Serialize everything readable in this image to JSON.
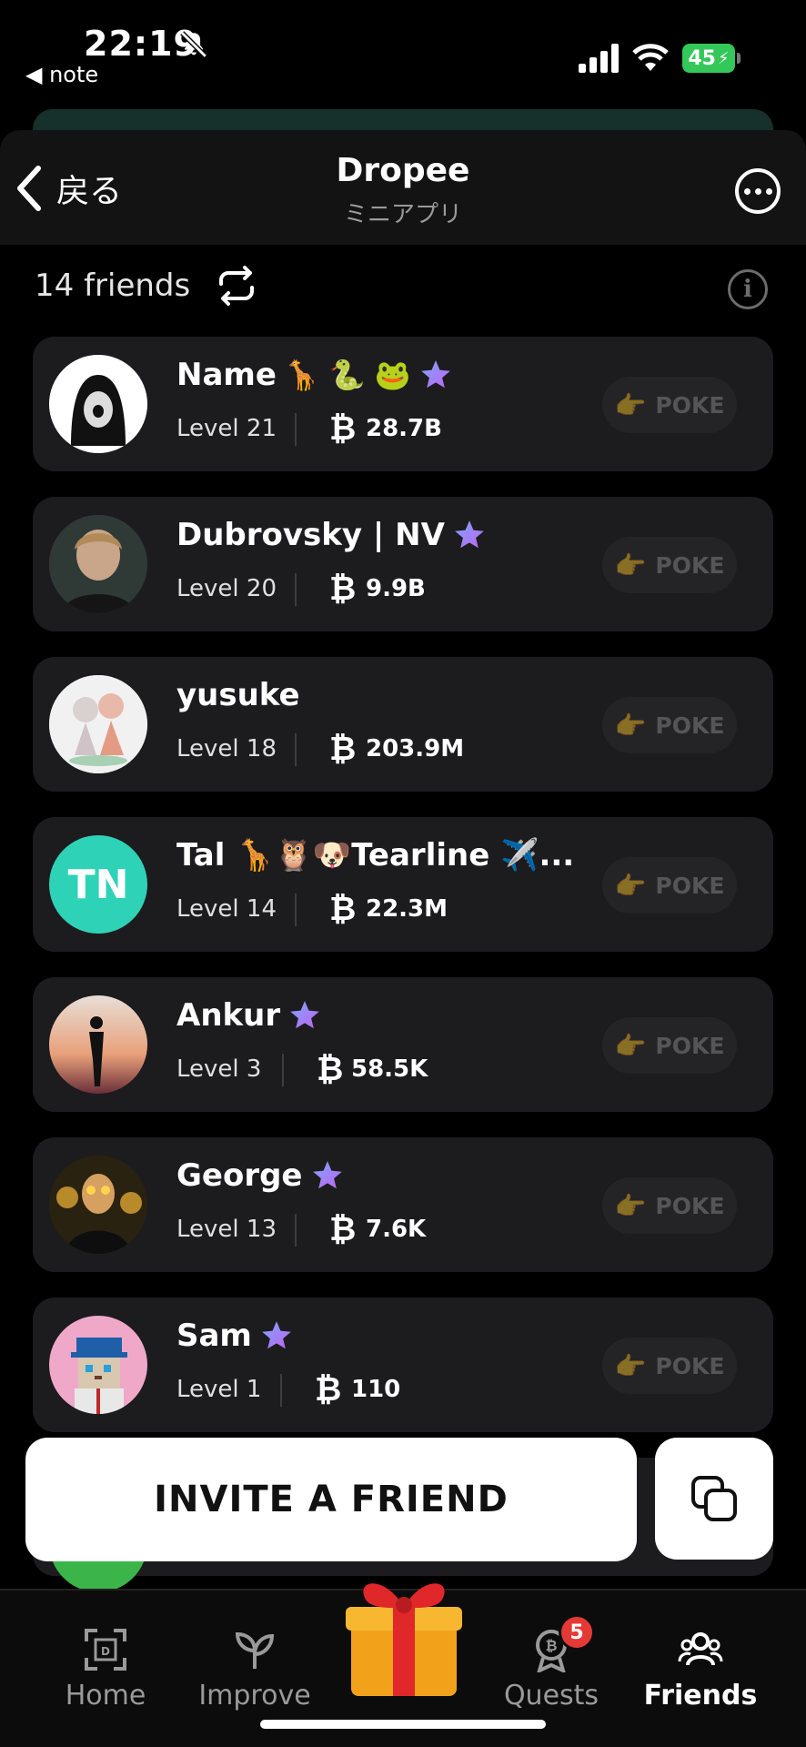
{
  "status": {
    "time": "22:19",
    "back_app": "◀ note",
    "battery": "45"
  },
  "header": {
    "back_label": "戻る",
    "title": "Dropee",
    "subtitle": "ミニアプリ"
  },
  "friends": {
    "count_label": "14 friends",
    "poke_label": "POKE",
    "coin_symbol": "₿",
    "items": [
      {
        "name": "Name",
        "emojis": "🦒 🐍 🐸",
        "star": true,
        "level": "Level 21",
        "amount": "28.7B"
      },
      {
        "name": "Dubrovsky | NV",
        "emojis": "",
        "star": true,
        "level": "Level 20",
        "amount": "9.9B"
      },
      {
        "name": "yusuke",
        "emojis": "",
        "star": false,
        "level": "Level 18",
        "amount": "203.9M"
      },
      {
        "name": "Tal 🦒🦉🐶Tearline ✈️...",
        "emojis": "",
        "star": false,
        "level": "Level 14",
        "amount": "22.3M",
        "initials": "TN"
      },
      {
        "name": "Ankur",
        "emojis": "",
        "star": true,
        "level": "Level 3",
        "amount": "58.5K"
      },
      {
        "name": "George",
        "emojis": "",
        "star": true,
        "level": "Level 13",
        "amount": "7.6K"
      },
      {
        "name": "Sam",
        "emojis": "",
        "star": true,
        "level": "Level 1",
        "amount": "110"
      }
    ]
  },
  "invite": {
    "label": "INVITE A FRIEND"
  },
  "nav": {
    "home": "Home",
    "improve": "Improve",
    "quests": "Quests",
    "quests_badge": "5",
    "friends": "Friends"
  },
  "colors": {
    "card": "#1c1c1e",
    "battery": "#34c759",
    "badge": "#e53935",
    "teal_avatar": "#2ed3b7"
  }
}
